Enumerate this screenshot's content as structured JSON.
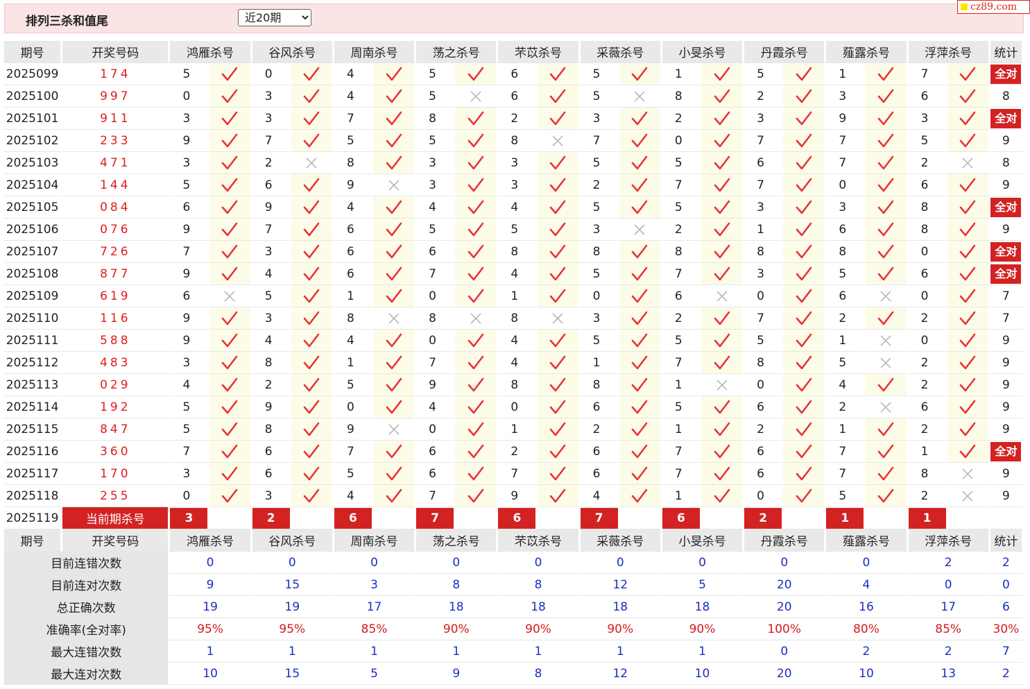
{
  "header": {
    "title": "排列三杀和值尾",
    "period_select": "近20期"
  },
  "logo": {
    "text": "cz89.com"
  },
  "columns": {
    "period": "期号",
    "draw": "开奖号码",
    "experts": [
      "鸿雁杀号",
      "谷风杀号",
      "周南杀号",
      "荡之杀号",
      "芣苡杀号",
      "采薇杀号",
      "小旻杀号",
      "丹霞杀号",
      "薤露杀号",
      "浮萍杀号"
    ],
    "stat": "统计"
  },
  "rows": [
    {
      "period": "2025099",
      "draw": "174",
      "kills": [
        5,
        0,
        4,
        5,
        6,
        5,
        1,
        5,
        1,
        7
      ],
      "ok": [
        1,
        1,
        1,
        1,
        1,
        1,
        1,
        1,
        1,
        1
      ],
      "stat": "全对"
    },
    {
      "period": "2025100",
      "draw": "997",
      "kills": [
        0,
        3,
        4,
        5,
        6,
        5,
        8,
        2,
        3,
        6
      ],
      "ok": [
        1,
        1,
        1,
        0,
        1,
        0,
        1,
        1,
        1,
        1
      ],
      "stat": "8"
    },
    {
      "period": "2025101",
      "draw": "911",
      "kills": [
        3,
        3,
        7,
        8,
        2,
        3,
        2,
        3,
        9,
        3
      ],
      "ok": [
        1,
        1,
        1,
        1,
        1,
        1,
        1,
        1,
        1,
        1
      ],
      "stat": "全对"
    },
    {
      "period": "2025102",
      "draw": "233",
      "kills": [
        9,
        7,
        5,
        5,
        8,
        7,
        0,
        7,
        7,
        5
      ],
      "ok": [
        1,
        1,
        1,
        1,
        0,
        1,
        1,
        1,
        1,
        1
      ],
      "stat": "9"
    },
    {
      "period": "2025103",
      "draw": "471",
      "kills": [
        3,
        2,
        8,
        3,
        3,
        5,
        5,
        6,
        7,
        2
      ],
      "ok": [
        1,
        0,
        1,
        1,
        1,
        1,
        1,
        1,
        1,
        0
      ],
      "stat": "8"
    },
    {
      "period": "2025104",
      "draw": "144",
      "kills": [
        5,
        6,
        9,
        3,
        3,
        2,
        7,
        7,
        0,
        6
      ],
      "ok": [
        1,
        1,
        0,
        1,
        1,
        1,
        1,
        1,
        1,
        1
      ],
      "stat": "9"
    },
    {
      "period": "2025105",
      "draw": "084",
      "kills": [
        6,
        9,
        4,
        4,
        4,
        5,
        5,
        3,
        3,
        8
      ],
      "ok": [
        1,
        1,
        1,
        1,
        1,
        1,
        1,
        1,
        1,
        1
      ],
      "stat": "全对"
    },
    {
      "period": "2025106",
      "draw": "076",
      "kills": [
        9,
        7,
        6,
        5,
        5,
        3,
        2,
        1,
        6,
        8
      ],
      "ok": [
        1,
        1,
        1,
        1,
        1,
        0,
        1,
        1,
        1,
        1
      ],
      "stat": "9"
    },
    {
      "period": "2025107",
      "draw": "726",
      "kills": [
        7,
        3,
        6,
        6,
        8,
        8,
        8,
        8,
        8,
        0
      ],
      "ok": [
        1,
        1,
        1,
        1,
        1,
        1,
        1,
        1,
        1,
        1
      ],
      "stat": "全对"
    },
    {
      "period": "2025108",
      "draw": "877",
      "kills": [
        9,
        4,
        6,
        7,
        4,
        5,
        7,
        3,
        5,
        6
      ],
      "ok": [
        1,
        1,
        1,
        1,
        1,
        1,
        1,
        1,
        1,
        1
      ],
      "stat": "全对"
    },
    {
      "period": "2025109",
      "draw": "619",
      "kills": [
        6,
        5,
        1,
        0,
        1,
        0,
        6,
        0,
        6,
        0
      ],
      "ok": [
        0,
        1,
        1,
        1,
        1,
        1,
        0,
        1,
        0,
        1
      ],
      "stat": "7"
    },
    {
      "period": "2025110",
      "draw": "116",
      "kills": [
        9,
        3,
        8,
        8,
        8,
        3,
        2,
        7,
        2,
        2
      ],
      "ok": [
        1,
        1,
        0,
        0,
        0,
        1,
        1,
        1,
        1,
        1
      ],
      "stat": "7"
    },
    {
      "period": "2025111",
      "draw": "588",
      "kills": [
        9,
        4,
        4,
        0,
        4,
        5,
        5,
        5,
        1,
        0
      ],
      "ok": [
        1,
        1,
        1,
        1,
        1,
        1,
        1,
        1,
        0,
        1
      ],
      "stat": "9"
    },
    {
      "period": "2025112",
      "draw": "483",
      "kills": [
        3,
        8,
        1,
        7,
        4,
        1,
        7,
        8,
        5,
        2
      ],
      "ok": [
        1,
        1,
        1,
        1,
        1,
        1,
        1,
        1,
        0,
        1
      ],
      "stat": "9"
    },
    {
      "period": "2025113",
      "draw": "029",
      "kills": [
        4,
        2,
        5,
        9,
        8,
        8,
        1,
        0,
        4,
        2
      ],
      "ok": [
        1,
        1,
        1,
        1,
        1,
        1,
        0,
        1,
        1,
        1
      ],
      "stat": "9"
    },
    {
      "period": "2025114",
      "draw": "192",
      "kills": [
        5,
        9,
        0,
        4,
        0,
        6,
        5,
        6,
        2,
        6
      ],
      "ok": [
        1,
        1,
        1,
        1,
        1,
        1,
        1,
        1,
        0,
        1
      ],
      "stat": "9"
    },
    {
      "period": "2025115",
      "draw": "847",
      "kills": [
        5,
        8,
        9,
        0,
        1,
        2,
        1,
        2,
        1,
        2
      ],
      "ok": [
        1,
        1,
        0,
        1,
        1,
        1,
        1,
        1,
        1,
        1
      ],
      "stat": "9"
    },
    {
      "period": "2025116",
      "draw": "360",
      "kills": [
        7,
        6,
        7,
        6,
        2,
        6,
        7,
        6,
        7,
        1
      ],
      "ok": [
        1,
        1,
        1,
        1,
        1,
        1,
        1,
        1,
        1,
        1
      ],
      "stat": "全对"
    },
    {
      "period": "2025117",
      "draw": "170",
      "kills": [
        3,
        6,
        5,
        6,
        7,
        6,
        7,
        6,
        7,
        8
      ],
      "ok": [
        1,
        1,
        1,
        1,
        1,
        1,
        1,
        1,
        1,
        0
      ],
      "stat": "9"
    },
    {
      "period": "2025118",
      "draw": "255",
      "kills": [
        0,
        3,
        4,
        7,
        9,
        4,
        1,
        0,
        5,
        2
      ],
      "ok": [
        1,
        1,
        1,
        1,
        1,
        1,
        1,
        1,
        1,
        0
      ],
      "stat": "9"
    }
  ],
  "current": {
    "period": "2025119",
    "label": "当前期杀号",
    "kills": [
      "3",
      "2",
      "6",
      "7",
      "6",
      "7",
      "6",
      "2",
      "1",
      "1"
    ]
  },
  "summary": [
    {
      "label": "目前连错次数",
      "values": [
        "0",
        "0",
        "0",
        "0",
        "0",
        "0",
        "0",
        "0",
        "0",
        "2"
      ],
      "stat": "2",
      "color": "blue"
    },
    {
      "label": "目前连对次数",
      "values": [
        "9",
        "15",
        "3",
        "8",
        "8",
        "12",
        "5",
        "20",
        "4",
        "0"
      ],
      "stat": "0",
      "color": "blue"
    },
    {
      "label": "总正确次数",
      "values": [
        "19",
        "19",
        "17",
        "18",
        "18",
        "18",
        "18",
        "20",
        "16",
        "17"
      ],
      "stat": "6",
      "color": "blue"
    },
    {
      "label": "准确率(全对率)",
      "values": [
        "95%",
        "95%",
        "85%",
        "90%",
        "90%",
        "90%",
        "90%",
        "100%",
        "80%",
        "85%"
      ],
      "stat": "30%",
      "color": "red"
    },
    {
      "label": "最大连错次数",
      "values": [
        "1",
        "1",
        "1",
        "1",
        "1",
        "1",
        "1",
        "0",
        "2",
        "2"
      ],
      "stat": "7",
      "color": "blue"
    },
    {
      "label": "最大连对次数",
      "values": [
        "10",
        "15",
        "5",
        "9",
        "8",
        "12",
        "10",
        "20",
        "10",
        "13"
      ],
      "stat": "2",
      "color": "blue"
    }
  ],
  "colors": {
    "accent": "#d32222",
    "check": "#e8333a",
    "cross": "#b9b9b9",
    "sum_blue": "#1a2fbf",
    "header_bg": "#fbe4e4"
  }
}
